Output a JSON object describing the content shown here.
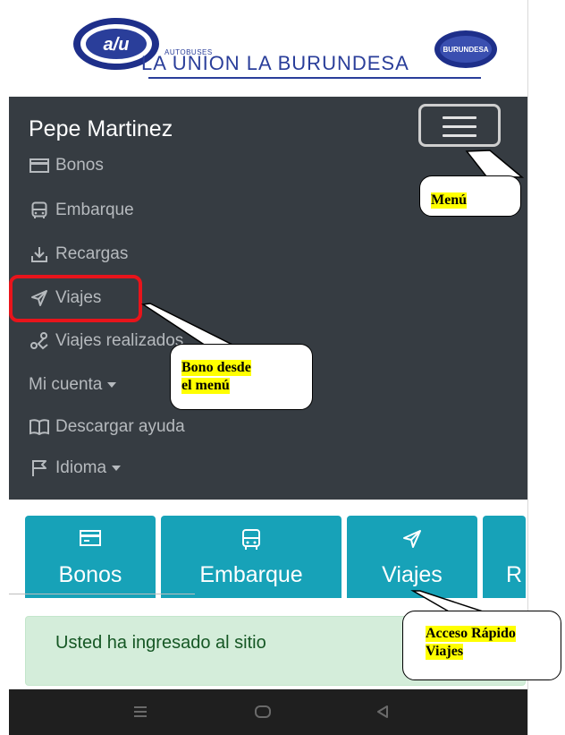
{
  "header": {
    "logo_left_text": "a/u",
    "logo_small_text": "AUTOBUSES",
    "logo_main_text": "LA UNION LA BURUNDESA",
    "logo_right_text": "BURUNDESA"
  },
  "menu": {
    "user_name": "Pepe Martinez",
    "items": [
      {
        "label": "Bonos",
        "icon": "card-icon"
      },
      {
        "label": "Embarque",
        "icon": "bus-icon"
      },
      {
        "label": "Recargas",
        "icon": "download-icon"
      },
      {
        "label": "Viajes",
        "icon": "send-icon"
      },
      {
        "label": "Viajes realizados",
        "icon": "route-icon"
      },
      {
        "label": "Mi cuenta",
        "icon": "caret-down-icon"
      },
      {
        "label": "Descargar ayuda",
        "icon": "book-icon"
      },
      {
        "label": "Idioma",
        "icon": "flag-icon"
      }
    ]
  },
  "quick_access": [
    {
      "label": "Bonos",
      "icon": "card-icon"
    },
    {
      "label": "Embarque",
      "icon": "bus-icon"
    },
    {
      "label": "Viajes",
      "icon": "send-icon"
    },
    {
      "label": "R",
      "icon": ""
    }
  ],
  "alert": {
    "text": "Usted ha ingresado al sitio"
  },
  "callouts": {
    "menu": "Menú",
    "bono_line1": "Bono desde",
    "bono_line2": "el menú",
    "acceso_line1": "Acceso Rápido",
    "acceso_line2": "Viajes"
  },
  "colors": {
    "menu_bg": "#363c42",
    "accent": "#17a2b8",
    "highlight": "#e8141b",
    "alert_bg": "#d4edda",
    "callout_highlight": "#ffff00"
  }
}
